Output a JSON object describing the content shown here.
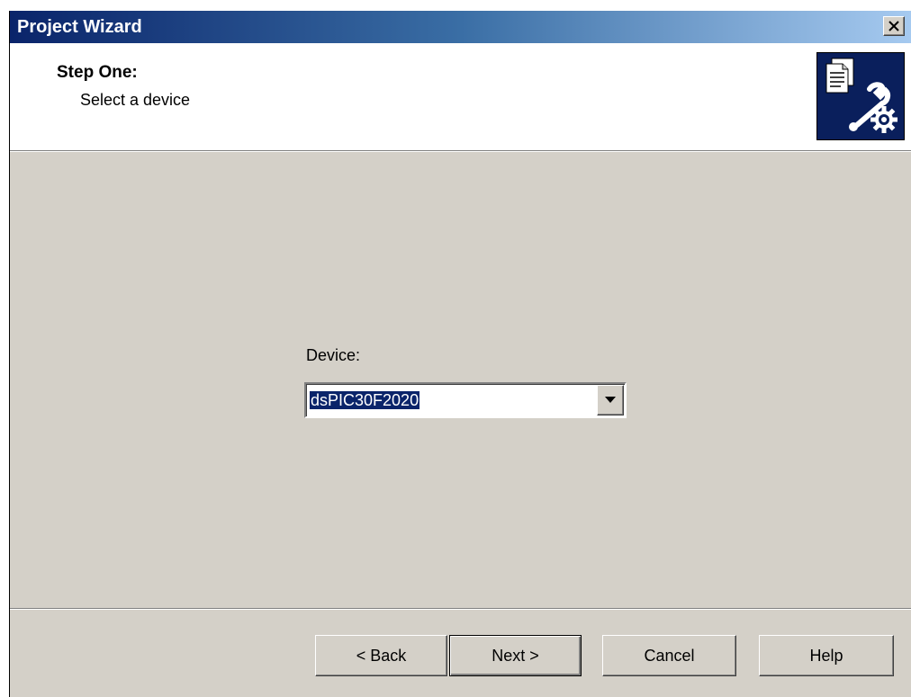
{
  "window": {
    "title": "Project Wizard"
  },
  "header": {
    "step_title": "Step One:",
    "step_subtitle": "Select a device",
    "icon": "wizard-documents-wrench-gear-icon"
  },
  "content": {
    "device_label": "Device:",
    "device_value": "dsPIC30F2020"
  },
  "footer": {
    "back_label": "< Back",
    "next_label": "Next >",
    "cancel_label": "Cancel",
    "help_label": "Help"
  },
  "colors": {
    "title_bar": "#0a246a",
    "dialog_background": "#d4d0c8",
    "selection_highlight": "#0a246a",
    "header_icon_background": "#0a1f5c"
  }
}
